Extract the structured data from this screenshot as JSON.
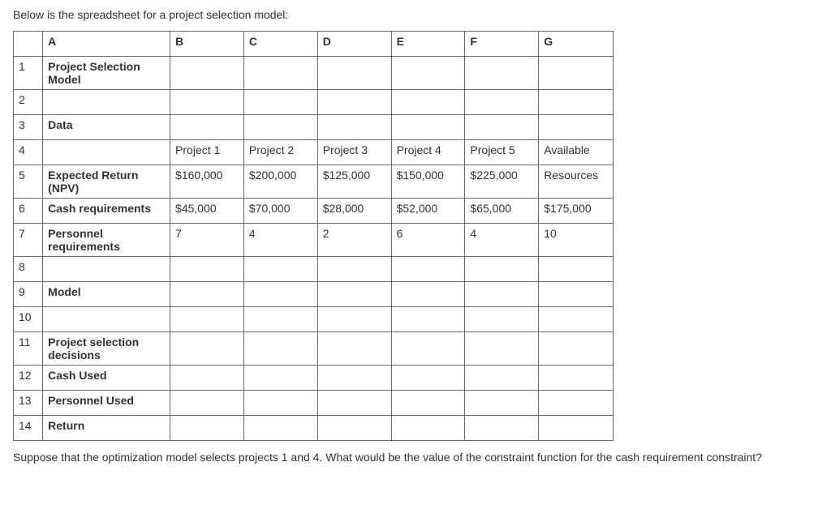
{
  "intro": "Below is the spreadsheet for a project selection model:",
  "columnHeaders": [
    "A",
    "B",
    "C",
    "D",
    "E",
    "F",
    "G"
  ],
  "rows": [
    {
      "num": "1",
      "a": "Project Selection Model",
      "bold": true,
      "b": "",
      "c": "",
      "d": "",
      "e": "",
      "f": "",
      "g": ""
    },
    {
      "num": "2",
      "a": "",
      "bold": false,
      "b": "",
      "c": "",
      "d": "",
      "e": "",
      "f": "",
      "g": ""
    },
    {
      "num": "3",
      "a": "Data",
      "bold": true,
      "b": "",
      "c": "",
      "d": "",
      "e": "",
      "f": "",
      "g": ""
    },
    {
      "num": "4",
      "a": "",
      "bold": false,
      "b": "Project 1",
      "c": "Project 2",
      "d": "Project 3",
      "e": "Project 4",
      "f": "Project 5",
      "g": "Available"
    },
    {
      "num": "5",
      "a": "Expected Return (NPV)",
      "bold": true,
      "b": "$160,000",
      "c": "$200,000",
      "d": "$125,000",
      "e": "$150,000",
      "f": "$225,000",
      "g": "Resources"
    },
    {
      "num": "6",
      "a": "Cash requirements",
      "bold": true,
      "b": "$45,000",
      "c": "$70,000",
      "d": "$28,000",
      "e": "$52,000",
      "f": "$65,000",
      "g": "$175,000"
    },
    {
      "num": "7",
      "a": "Personnel requirements",
      "bold": true,
      "b": "7",
      "c": "4",
      "d": "2",
      "e": "6",
      "f": "4",
      "g": "10"
    },
    {
      "num": "8",
      "a": "",
      "bold": false,
      "b": "",
      "c": "",
      "d": "",
      "e": "",
      "f": "",
      "g": ""
    },
    {
      "num": "9",
      "a": "Model",
      "bold": true,
      "b": "",
      "c": "",
      "d": "",
      "e": "",
      "f": "",
      "g": ""
    },
    {
      "num": "10",
      "a": "",
      "bold": false,
      "b": "",
      "c": "",
      "d": "",
      "e": "",
      "f": "",
      "g": ""
    },
    {
      "num": "11",
      "a": "Project selection decisions",
      "bold": true,
      "b": "",
      "c": "",
      "d": "",
      "e": "",
      "f": "",
      "g": ""
    },
    {
      "num": "12",
      "a": "Cash Used",
      "bold": true,
      "b": "",
      "c": "",
      "d": "",
      "e": "",
      "f": "",
      "g": ""
    },
    {
      "num": "13",
      "a": "Personnel Used",
      "bold": true,
      "b": "",
      "c": "",
      "d": "",
      "e": "",
      "f": "",
      "g": ""
    },
    {
      "num": "14",
      "a": "Return",
      "bold": true,
      "b": "",
      "c": "",
      "d": "",
      "e": "",
      "f": "",
      "g": ""
    }
  ],
  "question": "Suppose that the optimization model selects projects 1 and 4. What would be the value of the constraint function for the cash requirement constraint?"
}
